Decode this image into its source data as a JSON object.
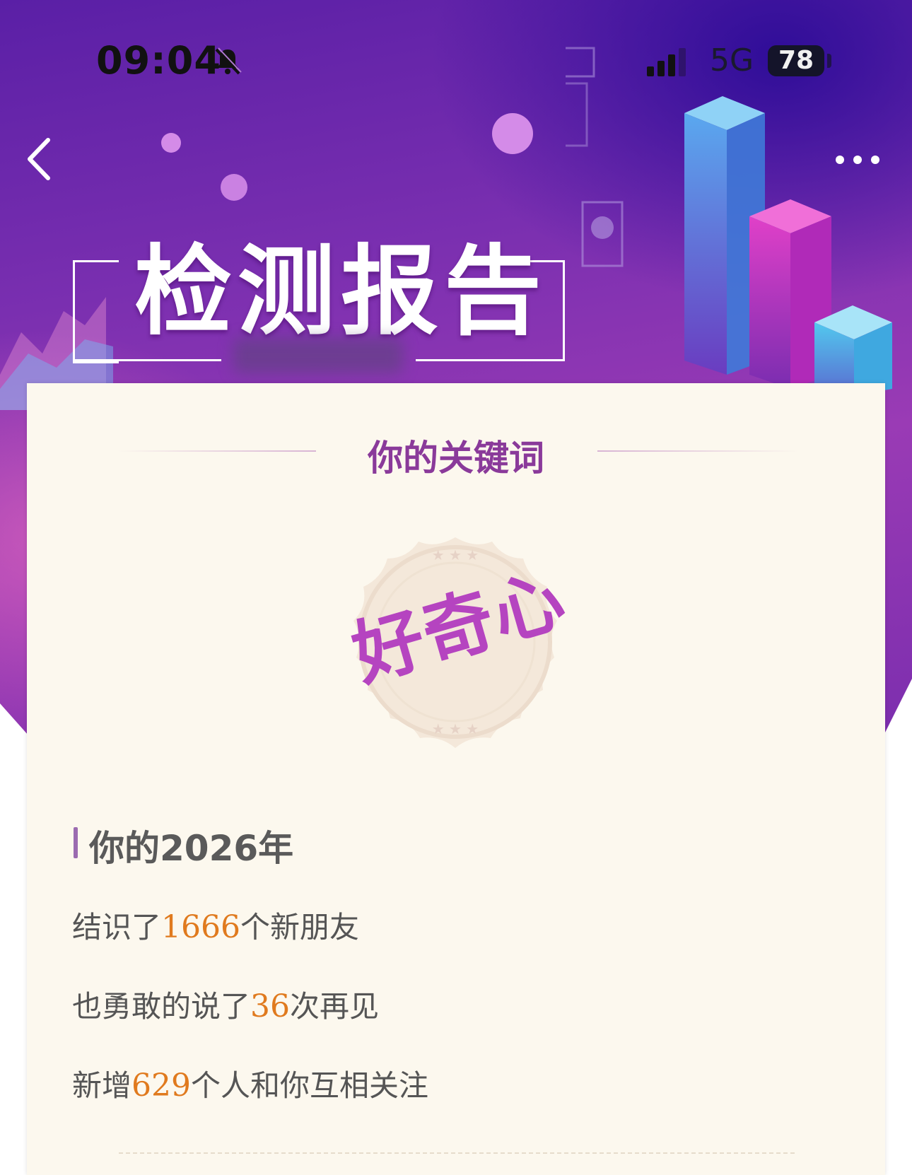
{
  "status_bar": {
    "time": "09:04",
    "network": "5G",
    "battery": "78"
  },
  "header": {
    "title": "检测报告"
  },
  "keyword_section": {
    "heading": "你的关键词",
    "keyword": "好奇心"
  },
  "year_section": {
    "heading": "你的2026年",
    "stats": [
      {
        "prefix": "结识了",
        "number": "1666",
        "suffix": "个新朋友"
      },
      {
        "prefix": "也勇敢的说了",
        "number": "36",
        "suffix": "次再见"
      },
      {
        "prefix": "新增",
        "number": "629",
        "suffix": "个人和你互相关注"
      }
    ]
  },
  "colors": {
    "accent_purple": "#8a3a9a",
    "number_orange": "#e07a1e",
    "card_bg": "#fcf8ee"
  }
}
